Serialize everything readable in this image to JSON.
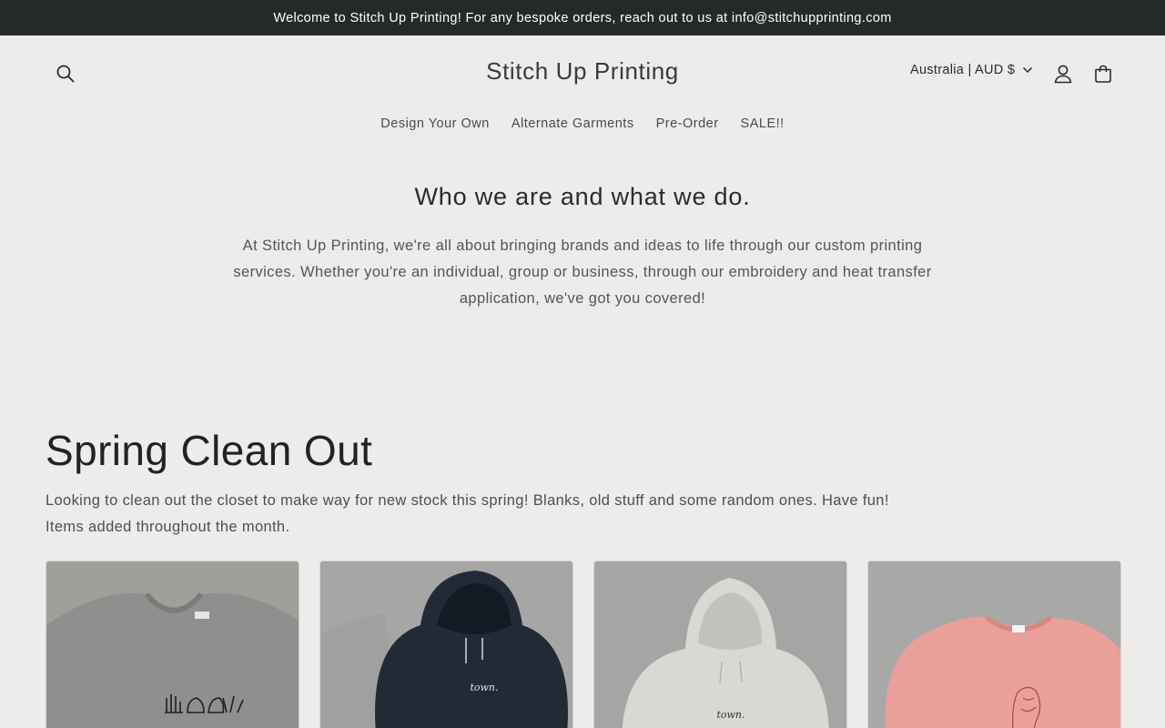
{
  "announcement": "Welcome to Stitch Up Printing! For any bespoke orders, reach out to us at info@stitchupprinting.com",
  "header": {
    "brand": "Stitch Up Printing",
    "locale": "Australia | AUD $"
  },
  "nav": {
    "items": [
      {
        "label": "Design Your Own"
      },
      {
        "label": "Alternate Garments"
      },
      {
        "label": "Pre-Order"
      },
      {
        "label": "SALE!!"
      }
    ]
  },
  "about": {
    "heading": "Who we are and what we do.",
    "body": "At Stitch Up Printing, we're all about bringing brands and ideas to life through our custom printing services. Whether you're an individual, group or business, through our embroidery and heat transfer application, we've got you covered!"
  },
  "collection": {
    "title": "Spring Clean Out",
    "description_line1": "Looking to clean out the closet to make way for new stock this spring! Blanks, old stuff and some random ones. Have fun!",
    "description_line2": "Items added throughout the month."
  },
  "products": [
    {
      "garment": "grey sweatshirt",
      "color": "#8f8f8d",
      "print": ""
    },
    {
      "garment": "navy hoodie",
      "color": "#222a37",
      "print": "town."
    },
    {
      "garment": "white hoodie",
      "color": "#d8d8d4",
      "print": "town."
    },
    {
      "garment": "pink sweatshirt",
      "color": "#e9a09a",
      "print": ""
    }
  ],
  "colors": {
    "announcement_bg": "#262a27",
    "page_bg": "#edecea",
    "text": "#2b2b2b"
  }
}
